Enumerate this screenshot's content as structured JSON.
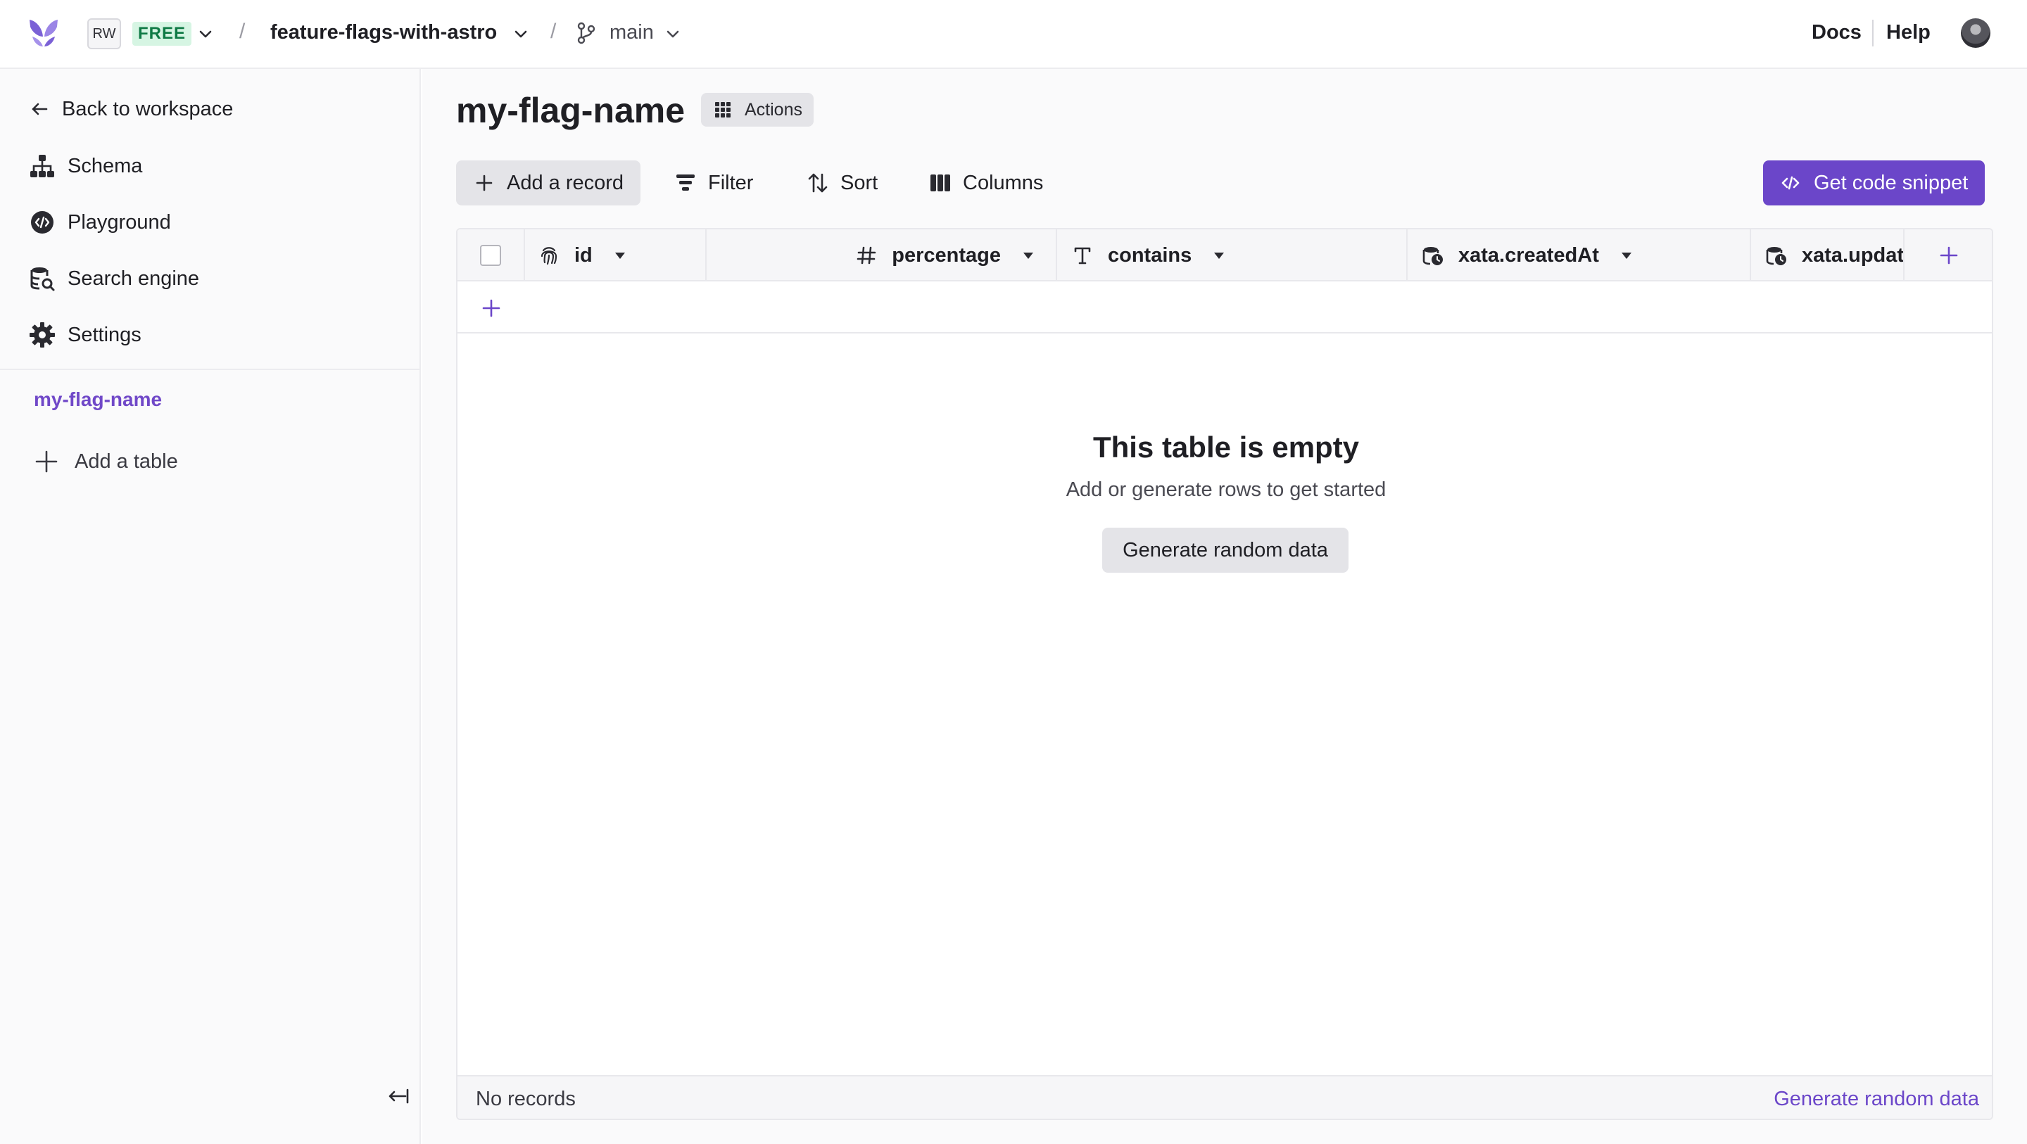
{
  "colors": {
    "accent": "#6b46c9",
    "plan_badge_bg": "#d6f5e3",
    "plan_badge_text": "#0f7a45"
  },
  "topbar": {
    "logo_icon": "xata-butterfly-logo",
    "workspace_initials": "RW",
    "plan": "FREE",
    "separator": "/",
    "database": "feature-flags-with-astro",
    "branch_icon": "git-branch-icon",
    "branch": "main",
    "docs_label": "Docs",
    "help_label": "Help"
  },
  "sidebar": {
    "back_label": "Back to workspace",
    "items": [
      {
        "label": "Schema",
        "icon": "schema-icon"
      },
      {
        "label": "Playground",
        "icon": "playground-icon"
      },
      {
        "label": "Search engine",
        "icon": "search-engine-icon"
      },
      {
        "label": "Settings",
        "icon": "gear-icon"
      }
    ],
    "tables": [
      "my-flag-name"
    ],
    "add_table_label": "Add a table"
  },
  "main": {
    "title": "my-flag-name",
    "actions_label": "Actions",
    "toolbar": {
      "add_record": "Add a record",
      "filter": "Filter",
      "sort": "Sort",
      "columns": "Columns",
      "snippet": "Get code snippet"
    },
    "columns": [
      {
        "name": "id",
        "type_icon": "fingerprint-icon"
      },
      {
        "name": "percentage",
        "type_icon": "hash-icon"
      },
      {
        "name": "contains",
        "type_icon": "text-type-icon"
      },
      {
        "name": "xata.createdAt",
        "type_icon": "datetime-icon"
      },
      {
        "name": "xata.updatedAt",
        "type_icon": "datetime-icon",
        "visible_text": "xata.updatе"
      }
    ],
    "empty": {
      "title": "This table is empty",
      "subtitle": "Add or generate rows to get started",
      "button": "Generate random data"
    },
    "footer": {
      "count": "No records",
      "generate": "Generate random data"
    }
  }
}
